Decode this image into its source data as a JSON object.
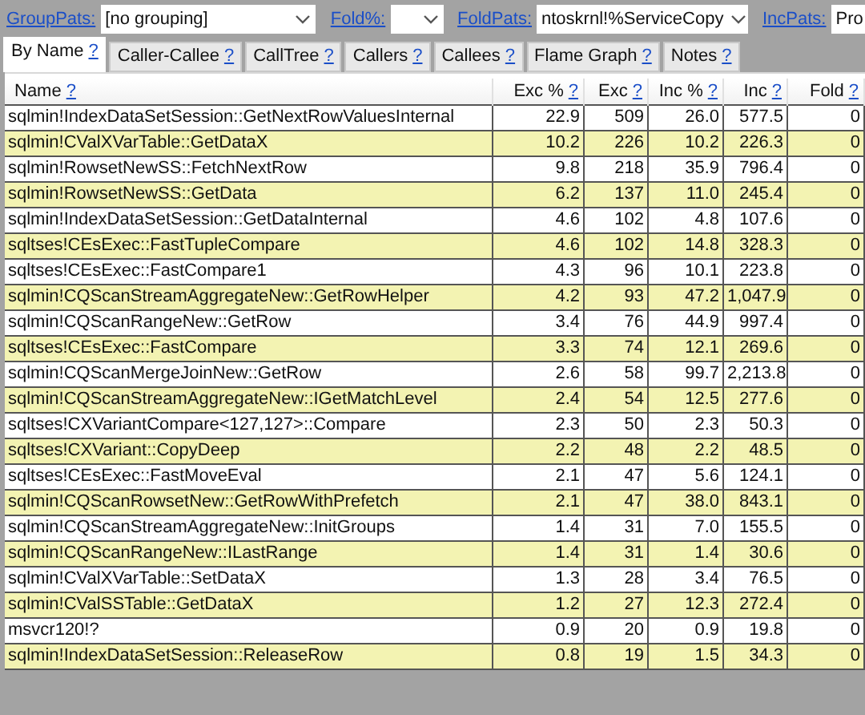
{
  "toolbar": {
    "fields": [
      {
        "label": "GroupPats:",
        "value": "[no grouping]"
      },
      {
        "label": "Fold%:"
      },
      {
        "label": "FoldPats:",
        "value": "ntoskrnl!%ServiceCopy"
      },
      {
        "label": "IncPats:",
        "value": "Pro"
      }
    ]
  },
  "tabs": [
    {
      "label": "By Name",
      "help": "?",
      "selected": true
    },
    {
      "label": "Caller-Callee",
      "help": "?",
      "selected": false
    },
    {
      "label": "CallTree",
      "help": "?",
      "selected": false
    },
    {
      "label": "Callers",
      "help": "?",
      "selected": false
    },
    {
      "label": "Callees",
      "help": "?",
      "selected": false
    },
    {
      "label": "Flame Graph",
      "help": "?",
      "selected": false
    },
    {
      "label": "Notes",
      "help": "?",
      "selected": false
    }
  ],
  "table": {
    "columns": [
      {
        "label": "Name",
        "help": "?"
      },
      {
        "label": "Exc %",
        "help": "?"
      },
      {
        "label": "Exc",
        "help": "?"
      },
      {
        "label": "Inc %",
        "help": "?"
      },
      {
        "label": "Inc",
        "help": "?"
      },
      {
        "label": "Fold",
        "help": "?"
      }
    ],
    "rows": [
      [
        "sqlmin!IndexDataSetSession::GetNextRowValuesInternal",
        "22.9",
        "509",
        "26.0",
        "577.5",
        "0"
      ],
      [
        "sqlmin!CValXVarTable::GetDataX",
        "10.2",
        "226",
        "10.2",
        "226.3",
        "0"
      ],
      [
        "sqlmin!RowsetNewSS::FetchNextRow",
        "9.8",
        "218",
        "35.9",
        "796.4",
        "0"
      ],
      [
        "sqlmin!RowsetNewSS::GetData",
        "6.2",
        "137",
        "11.0",
        "245.4",
        "0"
      ],
      [
        "sqlmin!IndexDataSetSession::GetDataInternal",
        "4.6",
        "102",
        "4.8",
        "107.6",
        "0"
      ],
      [
        "sqltses!CEsExec::FastTupleCompare",
        "4.6",
        "102",
        "14.8",
        "328.3",
        "0"
      ],
      [
        "sqltses!CEsExec::FastCompare1",
        "4.3",
        "96",
        "10.1",
        "223.8",
        "0"
      ],
      [
        "sqlmin!CQScanStreamAggregateNew::GetRowHelper",
        "4.2",
        "93",
        "47.2",
        "1,047.9",
        "0"
      ],
      [
        "sqlmin!CQScanRangeNew::GetRow",
        "3.4",
        "76",
        "44.9",
        "997.4",
        "0"
      ],
      [
        "sqltses!CEsExec::FastCompare",
        "3.3",
        "74",
        "12.1",
        "269.6",
        "0"
      ],
      [
        "sqlmin!CQScanMergeJoinNew::GetRow",
        "2.6",
        "58",
        "99.7",
        "2,213.8",
        "0"
      ],
      [
        "sqlmin!CQScanStreamAggregateNew::IGetMatchLevel",
        "2.4",
        "54",
        "12.5",
        "277.6",
        "0"
      ],
      [
        "sqltses!CXVariantCompare<127,127>::Compare",
        "2.3",
        "50",
        "2.3",
        "50.3",
        "0"
      ],
      [
        "sqltses!CXVariant::CopyDeep",
        "2.2",
        "48",
        "2.2",
        "48.5",
        "0"
      ],
      [
        "sqltses!CEsExec::FastMoveEval",
        "2.1",
        "47",
        "5.6",
        "124.1",
        "0"
      ],
      [
        "sqlmin!CQScanRowsetNew::GetRowWithPrefetch",
        "2.1",
        "47",
        "38.0",
        "843.1",
        "0"
      ],
      [
        "sqlmin!CQScanStreamAggregateNew::InitGroups",
        "1.4",
        "31",
        "7.0",
        "155.5",
        "0"
      ],
      [
        "sqlmin!CQScanRangeNew::ILastRange",
        "1.4",
        "31",
        "1.4",
        "30.6",
        "0"
      ],
      [
        "sqlmin!CValXVarTable::SetDataX",
        "1.3",
        "28",
        "3.4",
        "76.5",
        "0"
      ],
      [
        "sqlmin!CValSSTable::GetDataX",
        "1.2",
        "27",
        "12.3",
        "272.4",
        "0"
      ],
      [
        "msvcr120!?",
        "0.9",
        "20",
        "0.9",
        "19.8",
        "0"
      ],
      [
        "sqlmin!IndexDataSetSession::ReleaseRow",
        "0.8",
        "19",
        "1.5",
        "34.3",
        "0"
      ]
    ]
  }
}
